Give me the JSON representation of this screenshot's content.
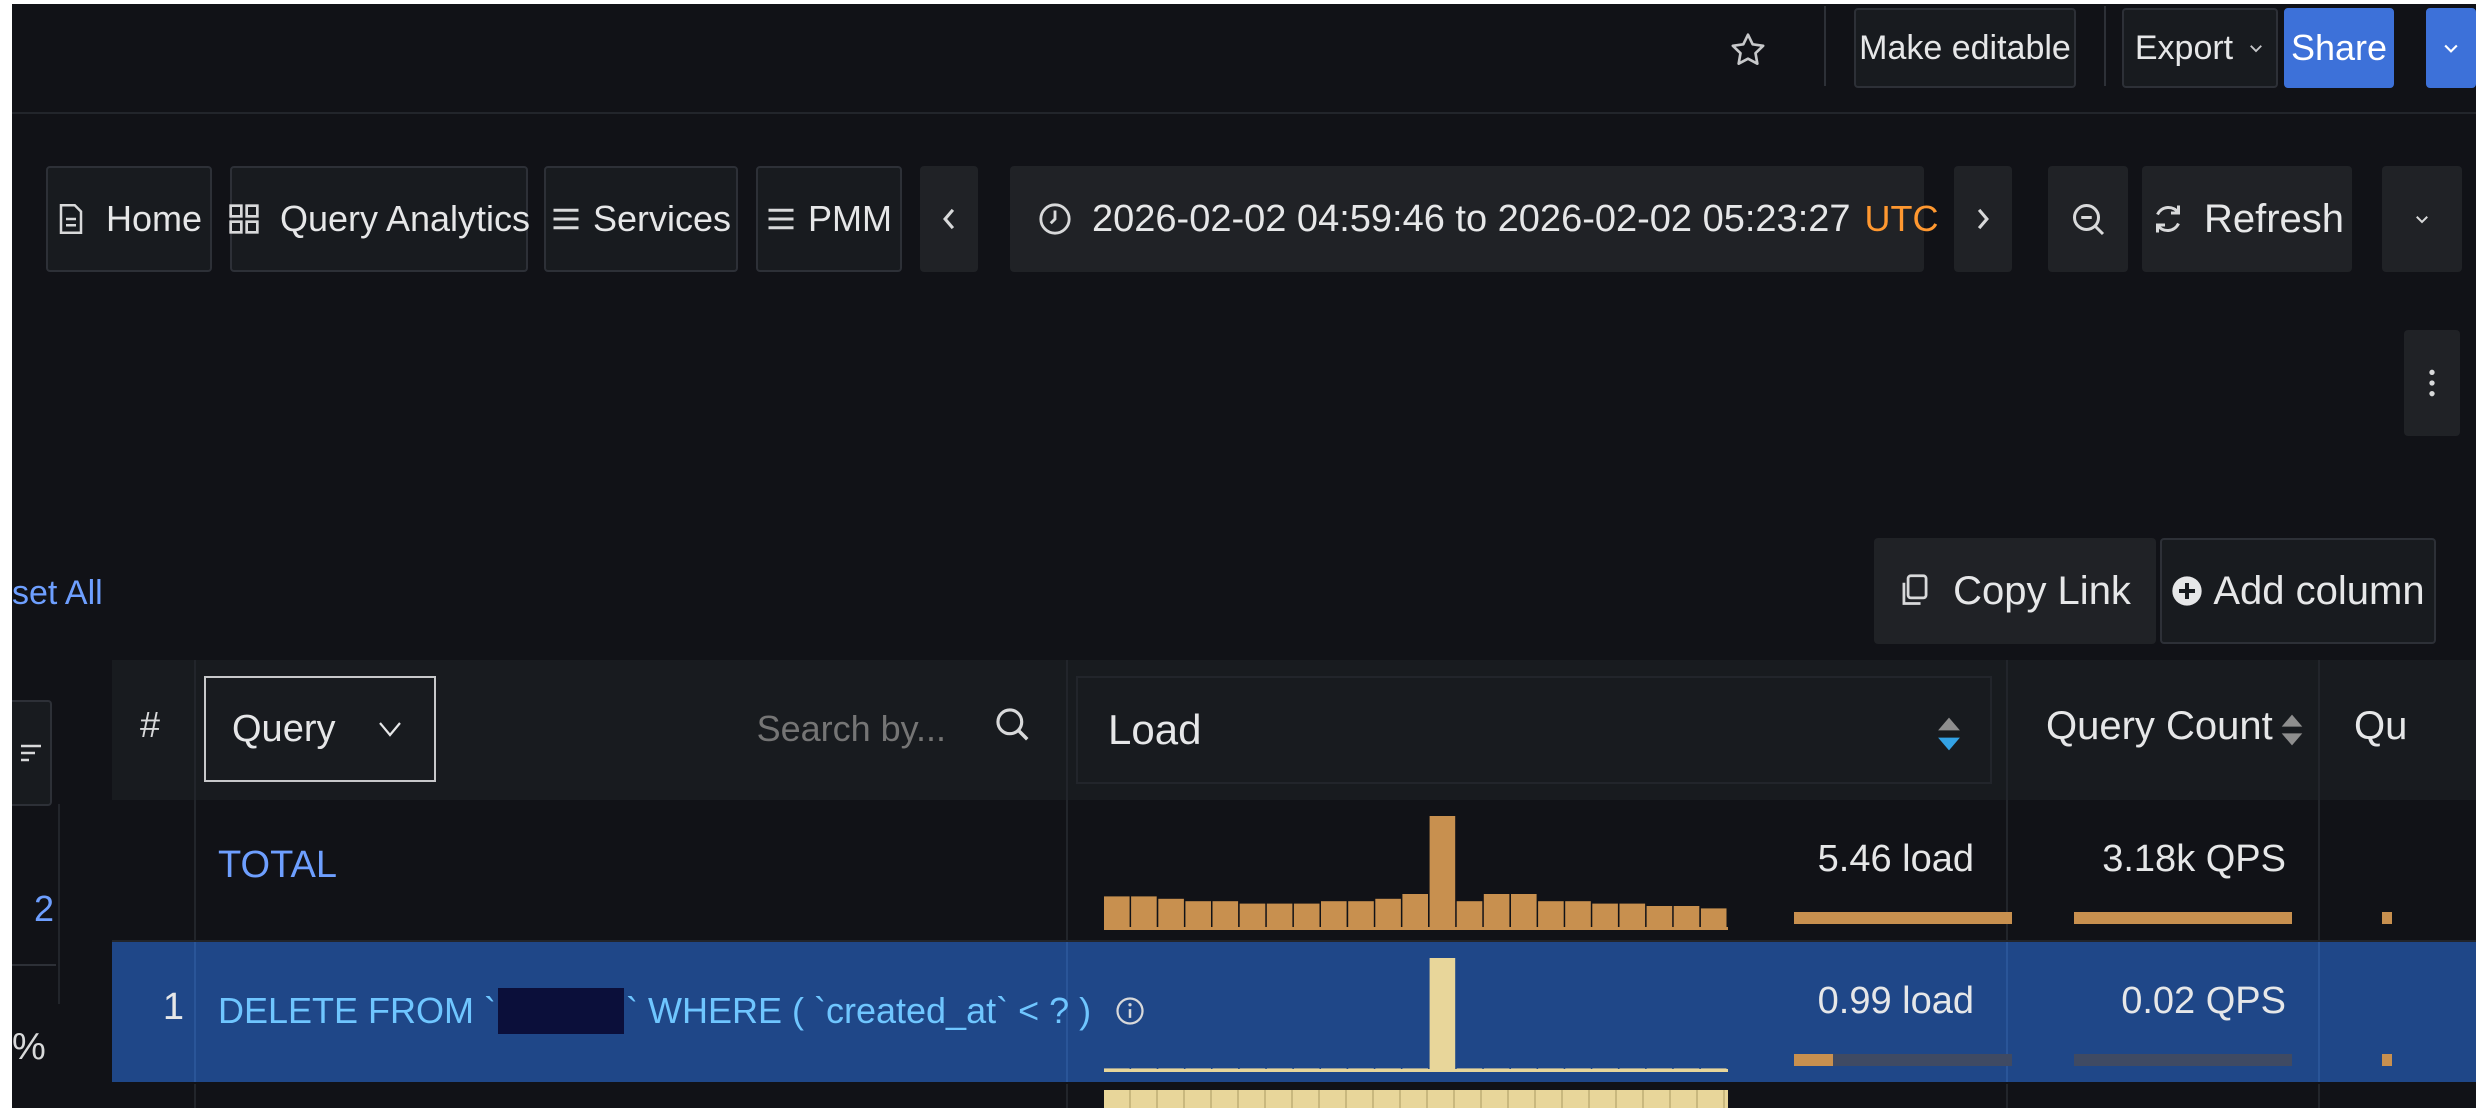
{
  "topbar": {
    "star_icon": "star-icon",
    "make_editable": "Make editable",
    "export": "Export",
    "share": "Share"
  },
  "nav": {
    "home": "Home",
    "query_analytics": "Query Analytics",
    "services": "Services",
    "pmm": "PMM",
    "time_range": "2026-02-02 04:59:46 to 2026-02-02 05:23:27",
    "timezone": "UTC",
    "refresh": "Refresh"
  },
  "toolbar": {
    "reset_all": "set All",
    "copy_link": "Copy Link",
    "add_column": "Add column"
  },
  "sidebar": {
    "count": "2",
    "percent": "%"
  },
  "table": {
    "headers": {
      "index": "#",
      "query_select": "Query",
      "search_placeholder": "Search by...",
      "load": "Load",
      "query_count": "Query Count",
      "next": "Qu"
    },
    "rows": [
      {
        "index": "",
        "query": "TOTAL",
        "load": "5.46 load",
        "load_fraction": 1.0,
        "qps": "3.18k QPS",
        "qps_fraction": 1.0,
        "spark_color": "#c8904f",
        "spark": [
          0.28,
          0.28,
          0.26,
          0.24,
          0.24,
          0.22,
          0.22,
          0.22,
          0.24,
          0.24,
          0.26,
          0.3,
          0.95,
          0.24,
          0.3,
          0.3,
          0.24,
          0.24,
          0.22,
          0.22,
          0.2,
          0.2,
          0.18
        ]
      },
      {
        "index": "1",
        "query_prefix": "DELETE FROM `",
        "query_suffix": "` WHERE ( `created_at` < ? )",
        "load": "0.99 load",
        "load_fraction": 0.18,
        "qps": "0.02 QPS",
        "qps_fraction": 0.0,
        "spark_color": "#e8d69a",
        "spark": [
          0.03,
          0.03,
          0.03,
          0.03,
          0.03,
          0.03,
          0.03,
          0.03,
          0.03,
          0.03,
          0.03,
          0.03,
          0.95,
          0.03,
          0.03,
          0.03,
          0.03,
          0.03,
          0.03,
          0.03,
          0.03,
          0.03,
          0.03
        ]
      }
    ]
  },
  "colors": {
    "accent_blue": "#3d71d9",
    "utc": "#ff9830",
    "load_bar": "#c8904f",
    "sort_active": "#33a2e5",
    "selected_row": "#1f4788"
  }
}
